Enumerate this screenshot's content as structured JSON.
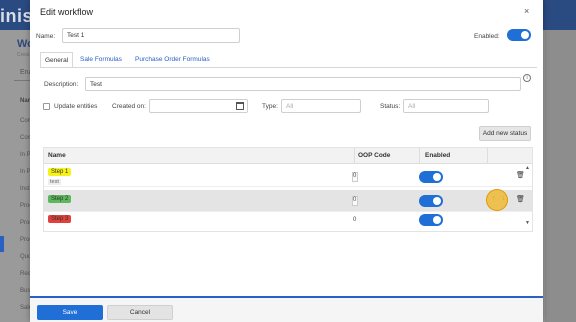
{
  "background": {
    "header_text": "inist",
    "page_title": "Wo",
    "page_sub": "Creat",
    "tab": "Ena",
    "name_header": "Nam",
    "list_items": [
      "Com",
      "Com",
      "In P",
      "In P",
      "Inst",
      "Prod",
      "Proc",
      "Prod",
      "Quo",
      "Rece",
      "Busi",
      "Sale"
    ]
  },
  "dialog": {
    "title": "Edit workflow",
    "close_glyph": "×",
    "name_label": "Name:",
    "name_value": "Test 1",
    "enabled_label": "Enabled:",
    "enabled": true,
    "tabs": [
      {
        "label": "General",
        "active": true
      },
      {
        "label": "Sale Formulas",
        "active": false
      },
      {
        "label": "Purchase Order Formulas",
        "active": false
      }
    ],
    "description_label": "Description:",
    "description_value": "Test",
    "info_glyph": "i",
    "update_entities_label": "Update entities",
    "created_on_label": "Created on:",
    "created_on_value": "",
    "type_label": "Type:",
    "type_placeholder": "All",
    "status_label": "Status:",
    "status_placeholder": "All",
    "add_status_button": "Add new status",
    "table": {
      "headers": {
        "name": "Name",
        "oop": "OOP Code",
        "enabled": "Enabled"
      },
      "rows": [
        {
          "step": "Step 1",
          "color": "#f5f21a",
          "description": "test",
          "oop": "0",
          "enabled": true,
          "selected": false
        },
        {
          "step": "Step 2",
          "color": "#5cb85c",
          "description": "",
          "oop": "0",
          "enabled": true,
          "selected": true
        },
        {
          "step": "Step 3",
          "color": "#e0413a",
          "description": "",
          "oop": "0",
          "enabled": true,
          "selected": false
        }
      ],
      "trash_glyph": "🗑",
      "up_glyph": "↑",
      "down_glyph": "↓",
      "scroll_up_glyph": "▲",
      "scroll_down_glyph": "▼"
    },
    "save_button": "Save",
    "cancel_button": "Cancel"
  },
  "colors": {
    "accent": "#1f6fd6",
    "header": "#2a4a82",
    "cursor": "#f0b41e"
  }
}
